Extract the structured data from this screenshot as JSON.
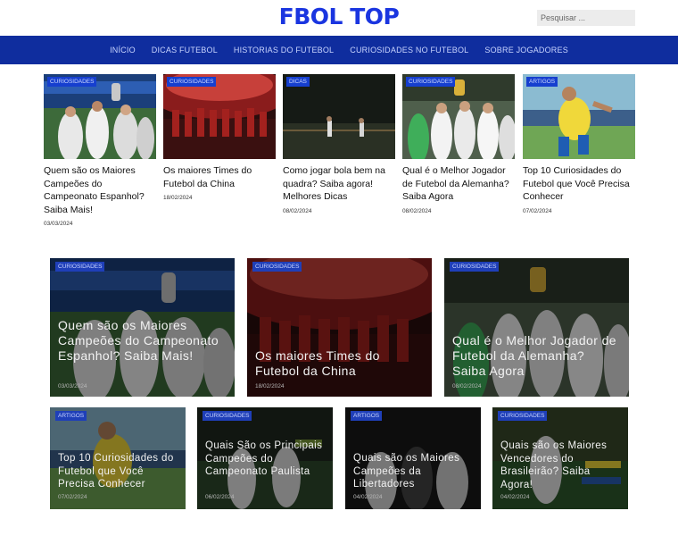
{
  "site": {
    "logo": "FBOL TOP"
  },
  "search": {
    "placeholder": "Pesquisar ..."
  },
  "nav": [
    "INÍCIO",
    "DICAS FUTEBOL",
    "HISTORIAS DO FUTEBOL",
    "CURIOSIDADES NO FUTEBOL",
    "SOBRE JOGADORES"
  ],
  "top_posts": [
    {
      "tag": "CURIOSIDADES",
      "title": "Quem são os Maiores Campeões do Campeonato Espanhol? Saiba Mais!",
      "date": "03/03/2024"
    },
    {
      "tag": "CURIOSIDADES",
      "title": "Os maiores Times do Futebol da China",
      "date": "18/02/2024"
    },
    {
      "tag": "DICAS",
      "title": "Como jogar bola bem na quadra? Saiba agora! Melhores Dicas",
      "date": "08/02/2024"
    },
    {
      "tag": "CURIOSIDADES",
      "title": "Qual é o Melhor Jogador de Futebol da Alemanha? Saiba Agora",
      "date": "08/02/2024"
    },
    {
      "tag": "ARTIGOS",
      "title": "Top 10 Curiosidades do Futebol que Você Precisa Conhecer",
      "date": "07/02/2024"
    }
  ],
  "featured_large": [
    {
      "tag": "CURIOSIDADES",
      "title": "Quem são os Maiores Campeões do Campeonato Espanhol? Saiba Mais!",
      "date": "03/03/2024"
    },
    {
      "tag": "CURIOSIDADES",
      "title": "Os maiores Times do Futebol da China",
      "date": "18/02/2024"
    },
    {
      "tag": "CURIOSIDADES",
      "title": "Qual é o Melhor Jogador de Futebol da Alemanha? Saiba Agora",
      "date": "08/02/2024"
    }
  ],
  "featured_small": [
    {
      "tag": "ARTIGOS",
      "title": "Top 10 Curiosidades do Futebol que Você Precisa Conhecer",
      "date": "07/02/2024"
    },
    {
      "tag": "CURIOSIDADES",
      "title": "Quais São os Principais Campeões do Campeonato Paulista",
      "date": "06/02/2024"
    },
    {
      "tag": "ARTIGOS",
      "title": "Quais são os Maiores Campeões da Libertadores",
      "date": "04/02/2024"
    },
    {
      "tag": "CURIOSIDADES",
      "title": "Quais são os Maiores Vencedores do Brasileirão? Saiba Agora!",
      "date": "04/02/2024"
    }
  ],
  "colors": {
    "brand": "#1a35e0",
    "nav_bg": "#0f2d9e",
    "tag_bg": "#163fcf"
  }
}
